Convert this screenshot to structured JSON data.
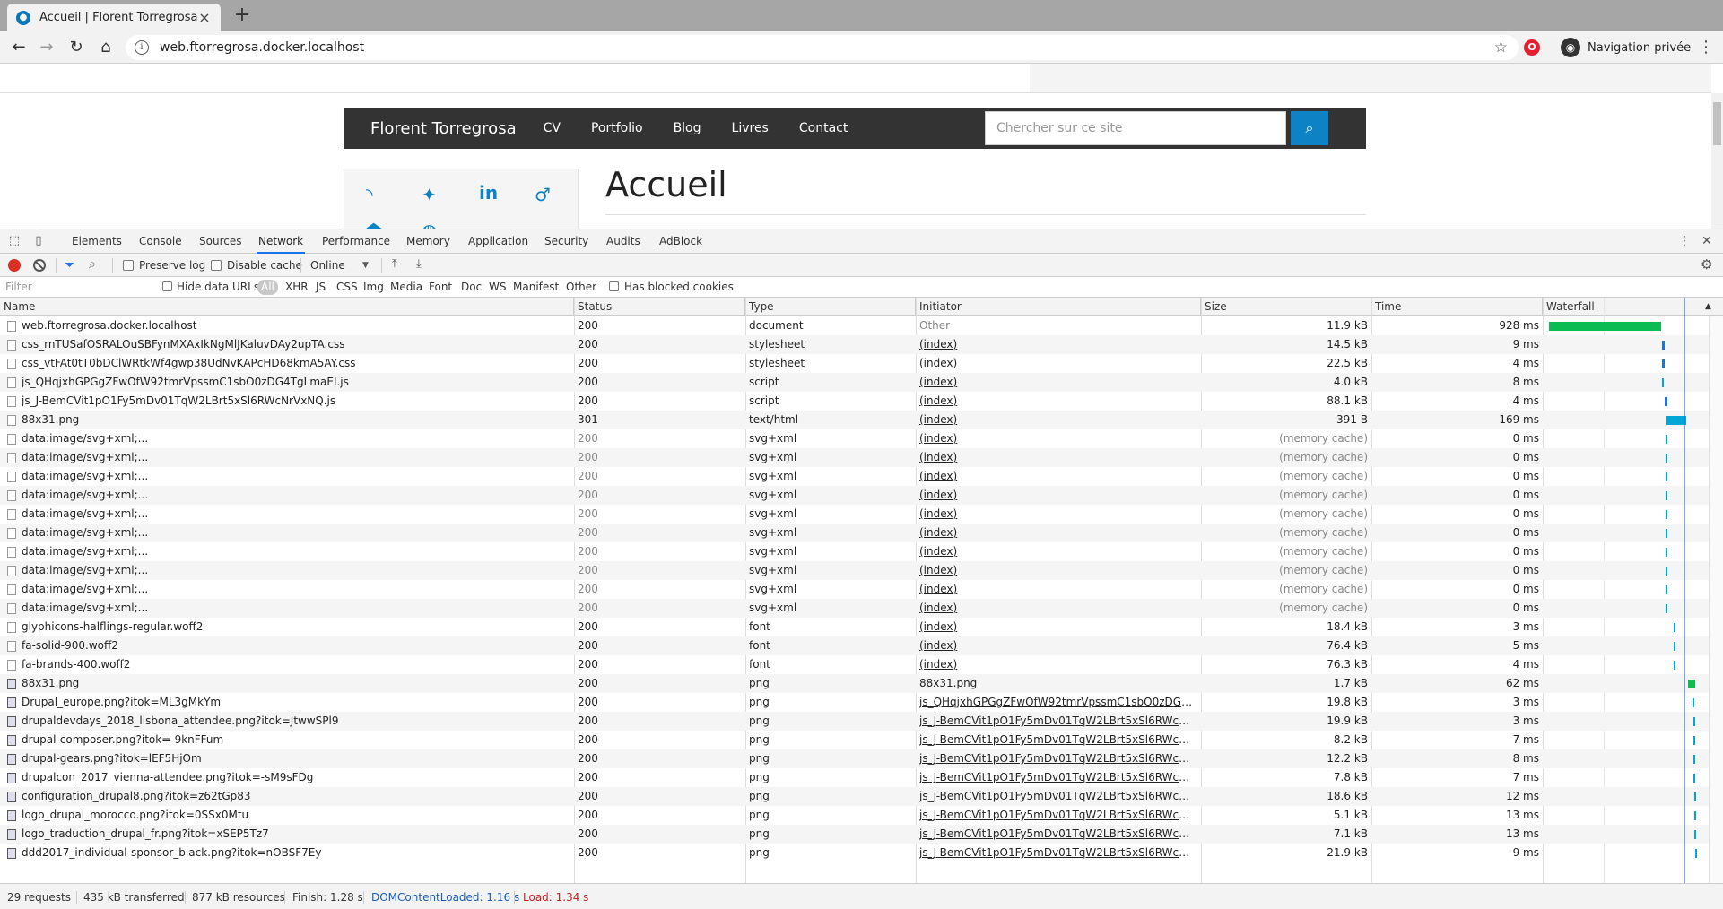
{
  "browser": {
    "tab_title": "Accueil | Florent Torregrosa",
    "url": "web.ftorregrosa.docker.localhost",
    "incognito_label": "Navigation privée"
  },
  "site": {
    "brand": "Florent Torregrosa",
    "nav": [
      "CV",
      "Portfolio",
      "Blog",
      "Livres",
      "Contact"
    ],
    "search_placeholder": "Chercher sur ce site",
    "heading": "Accueil"
  },
  "devtools": {
    "tabs": [
      "Elements",
      "Console",
      "Sources",
      "Network",
      "Performance",
      "Memory",
      "Application",
      "Security",
      "Audits",
      "AdBlock"
    ],
    "active_tab": "Network",
    "toolbar": {
      "preserve_log": "Preserve log",
      "disable_cache": "Disable cache",
      "throttle": "Online"
    },
    "filterbar": {
      "filter_placeholder": "Filter",
      "hide_data_urls": "Hide data URLs",
      "types": [
        "All",
        "XHR",
        "JS",
        "CSS",
        "Img",
        "Media",
        "Font",
        "Doc",
        "WS",
        "Manifest",
        "Other"
      ],
      "active_type": "All",
      "blocked_cookies": "Has blocked cookies"
    },
    "columns": [
      "Name",
      "Status",
      "Type",
      "Initiator",
      "Size",
      "Time",
      "Waterfall"
    ],
    "rows": [
      {
        "name": "web.ftorregrosa.docker.localhost",
        "status": "200",
        "type": "document",
        "initiator": "Other",
        "size": "11.9 kB",
        "time": "928 ms"
      },
      {
        "name": "css_rnTUSafOSRALOuSBFynMXAxIkNgMlJKaluvDAy2upTA.css",
        "status": "200",
        "type": "stylesheet",
        "initiator": "(index)",
        "size": "14.5 kB",
        "time": "9 ms"
      },
      {
        "name": "css_vtFAt0tT0bDClWRtkWf4gwp38UdNvKAPcHD68kmA5AY.css",
        "status": "200",
        "type": "stylesheet",
        "initiator": "(index)",
        "size": "22.5 kB",
        "time": "4 ms"
      },
      {
        "name": "js_QHqjxhGPGgZFwOfW92tmrVpssmC1sbO0zDG4TgLmaEI.js",
        "status": "200",
        "type": "script",
        "initiator": "(index)",
        "size": "4.0 kB",
        "time": "8 ms"
      },
      {
        "name": "js_J-BemCVit1pO1Fy5mDv01TqW2LBrt5xSl6RWcNrVxNQ.js",
        "status": "200",
        "type": "script",
        "initiator": "(index)",
        "size": "88.1 kB",
        "time": "4 ms"
      },
      {
        "name": "88x31.png",
        "status": "301",
        "type": "text/html",
        "initiator": "(index)",
        "size": "391 B",
        "time": "169 ms"
      },
      {
        "name": "data:image/svg+xml;...",
        "status": "200",
        "type": "svg+xml",
        "initiator": "(index)",
        "size": "(memory cache)",
        "time": "0 ms"
      },
      {
        "name": "data:image/svg+xml;...",
        "status": "200",
        "type": "svg+xml",
        "initiator": "(index)",
        "size": "(memory cache)",
        "time": "0 ms"
      },
      {
        "name": "data:image/svg+xml;...",
        "status": "200",
        "type": "svg+xml",
        "initiator": "(index)",
        "size": "(memory cache)",
        "time": "0 ms"
      },
      {
        "name": "data:image/svg+xml;...",
        "status": "200",
        "type": "svg+xml",
        "initiator": "(index)",
        "size": "(memory cache)",
        "time": "0 ms"
      },
      {
        "name": "data:image/svg+xml;...",
        "status": "200",
        "type": "svg+xml",
        "initiator": "(index)",
        "size": "(memory cache)",
        "time": "0 ms"
      },
      {
        "name": "data:image/svg+xml;...",
        "status": "200",
        "type": "svg+xml",
        "initiator": "(index)",
        "size": "(memory cache)",
        "time": "0 ms"
      },
      {
        "name": "data:image/svg+xml;...",
        "status": "200",
        "type": "svg+xml",
        "initiator": "(index)",
        "size": "(memory cache)",
        "time": "0 ms"
      },
      {
        "name": "data:image/svg+xml;...",
        "status": "200",
        "type": "svg+xml",
        "initiator": "(index)",
        "size": "(memory cache)",
        "time": "0 ms"
      },
      {
        "name": "data:image/svg+xml;...",
        "status": "200",
        "type": "svg+xml",
        "initiator": "(index)",
        "size": "(memory cache)",
        "time": "0 ms"
      },
      {
        "name": "data:image/svg+xml;...",
        "status": "200",
        "type": "svg+xml",
        "initiator": "(index)",
        "size": "(memory cache)",
        "time": "0 ms"
      },
      {
        "name": "glyphicons-halflings-regular.woff2",
        "status": "200",
        "type": "font",
        "initiator": "(index)",
        "size": "18.4 kB",
        "time": "3 ms"
      },
      {
        "name": "fa-solid-900.woff2",
        "status": "200",
        "type": "font",
        "initiator": "(index)",
        "size": "76.4 kB",
        "time": "5 ms"
      },
      {
        "name": "fa-brands-400.woff2",
        "status": "200",
        "type": "font",
        "initiator": "(index)",
        "size": "76.3 kB",
        "time": "4 ms"
      },
      {
        "name": "88x31.png",
        "status": "200",
        "type": "png",
        "initiator": "88x31.png",
        "size": "1.7 kB",
        "time": "62 ms"
      },
      {
        "name": "Drupal_europe.png?itok=ML3gMkYm",
        "status": "200",
        "type": "png",
        "initiator": "js_QHqjxhGPGgZFwOfW92tmrVpssmC1sbO0zDG4TgL...",
        "size": "19.8 kB",
        "time": "3 ms"
      },
      {
        "name": "drupaldevdays_2018_lisbona_attendee.png?itok=JtwwSPl9",
        "status": "200",
        "type": "png",
        "initiator": "js_J-BemCVit1pO1Fy5mDv01TqW2LBrt5xSl6RWcNrVx...",
        "size": "19.9 kB",
        "time": "3 ms"
      },
      {
        "name": "drupal-composer.png?itok=-9knFFum",
        "status": "200",
        "type": "png",
        "initiator": "js_J-BemCVit1pO1Fy5mDv01TqW2LBrt5xSl6RWcNrVx...",
        "size": "8.2 kB",
        "time": "7 ms"
      },
      {
        "name": "drupal-gears.png?itok=lEF5HjOm",
        "status": "200",
        "type": "png",
        "initiator": "js_J-BemCVit1pO1Fy5mDv01TqW2LBrt5xSl6RWcNrVx...",
        "size": "12.2 kB",
        "time": "8 ms"
      },
      {
        "name": "drupalcon_2017_vienna-attendee.png?itok=-sM9sFDg",
        "status": "200",
        "type": "png",
        "initiator": "js_J-BemCVit1pO1Fy5mDv01TqW2LBrt5xSl6RWcNrVx...",
        "size": "7.8 kB",
        "time": "7 ms"
      },
      {
        "name": "configuration_drupal8.png?itok=z62tGp83",
        "status": "200",
        "type": "png",
        "initiator": "js_J-BemCVit1pO1Fy5mDv01TqW2LBrt5xSl6RWcNrVx...",
        "size": "18.6 kB",
        "time": "12 ms"
      },
      {
        "name": "logo_drupal_morocco.png?itok=0SSx0Mtu",
        "status": "200",
        "type": "png",
        "initiator": "js_J-BemCVit1pO1Fy5mDv01TqW2LBrt5xSl6RWcNrVx...",
        "size": "5.1 kB",
        "time": "13 ms"
      },
      {
        "name": "logo_traduction_drupal_fr.png?itok=xSEP5Tz7",
        "status": "200",
        "type": "png",
        "initiator": "js_J-BemCVit1pO1Fy5mDv01TqW2LBrt5xSl6RWcNrVx...",
        "size": "7.1 kB",
        "time": "13 ms"
      },
      {
        "name": "ddd2017_individual-sponsor_black.png?itok=nOBSF7Ey",
        "status": "200",
        "type": "png",
        "initiator": "js_J-BemCVit1pO1Fy5mDv01TqW2LBrt5xSl6RWcNrVx...",
        "size": "21.9 kB",
        "time": "9 ms"
      }
    ],
    "status_bar": {
      "requests": "29 requests",
      "transferred": "435 kB transferred",
      "resources": "877 kB resources",
      "finish": "Finish: 1.28 s",
      "dcl": "DOMContentLoaded: 1.16 s",
      "load": "Load: 1.34 s"
    },
    "colors": {
      "waterfall_green": "#0cbb52",
      "waterfall_blue": "#1a73e8",
      "waterfall_teal": "#00a6d6"
    }
  }
}
